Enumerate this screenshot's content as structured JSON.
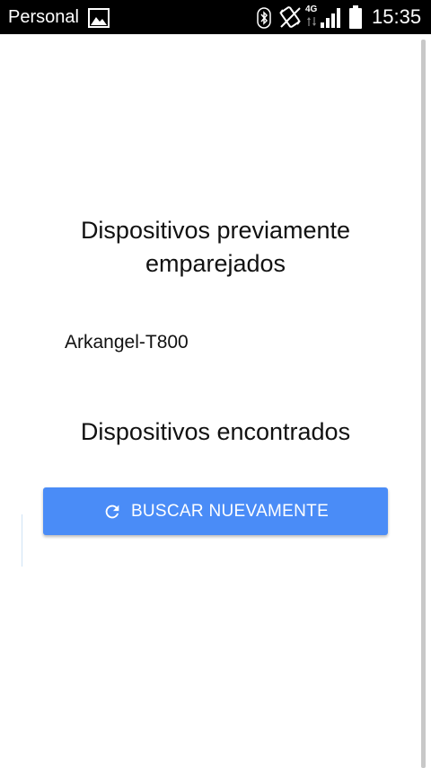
{
  "status_bar": {
    "carrier": "Personal",
    "network_type": "4G",
    "time": "15:35",
    "icons": [
      "gallery-icon",
      "bluetooth-icon",
      "vibrate-icon",
      "data-arrows-icon",
      "signal-icon",
      "battery-icon"
    ]
  },
  "main": {
    "paired_title": "Dispositivos previamente emparejados",
    "paired_devices": [
      "Arkangel-T800"
    ],
    "found_title": "Dispositivos encontrados",
    "search_button_label": "BUSCAR NUEVAMENTE",
    "search_button_icon": "refresh-icon"
  },
  "colors": {
    "status_bar_bg": "#000000",
    "button_bg": "#4a8cf7",
    "button_text": "#ffffff",
    "text": "#111111"
  }
}
